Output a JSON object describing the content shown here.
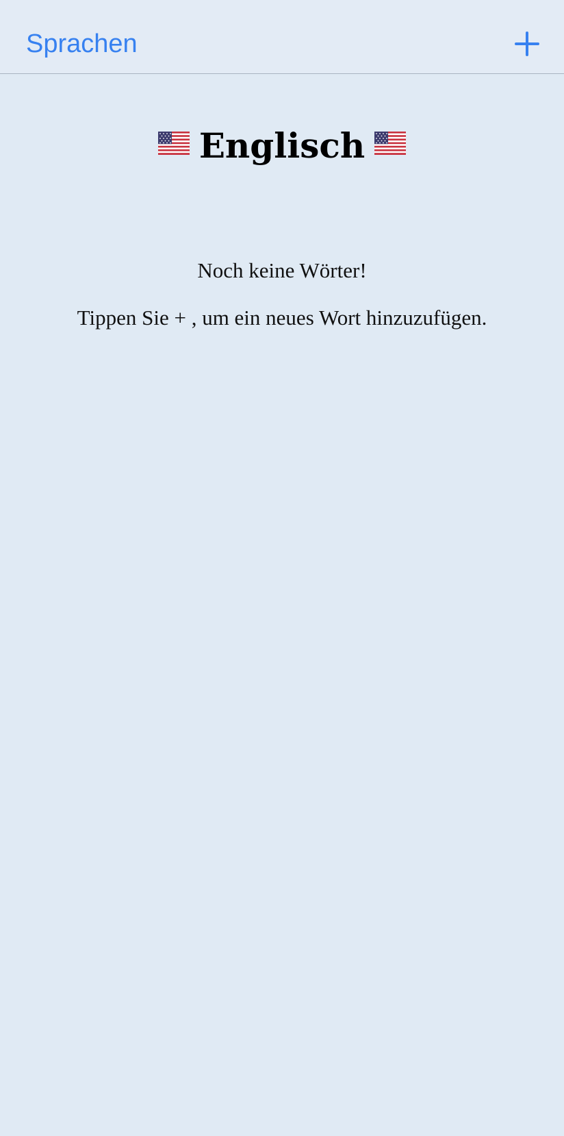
{
  "nav": {
    "back_label": "Sprachen",
    "add_icon": "plus-icon",
    "accent_color": "#3781f0"
  },
  "language": {
    "name": "Englisch",
    "flag_icon": "us-flag-icon"
  },
  "empty_state": {
    "title": "Noch keine Wörter!",
    "hint": "Tippen Sie + , um ein neues Wort hinzuzufügen."
  },
  "colors": {
    "background": "#e0eaf4",
    "nav_background": "#e3ebf5",
    "separator": "#a9b4c0",
    "text": "#111111"
  }
}
